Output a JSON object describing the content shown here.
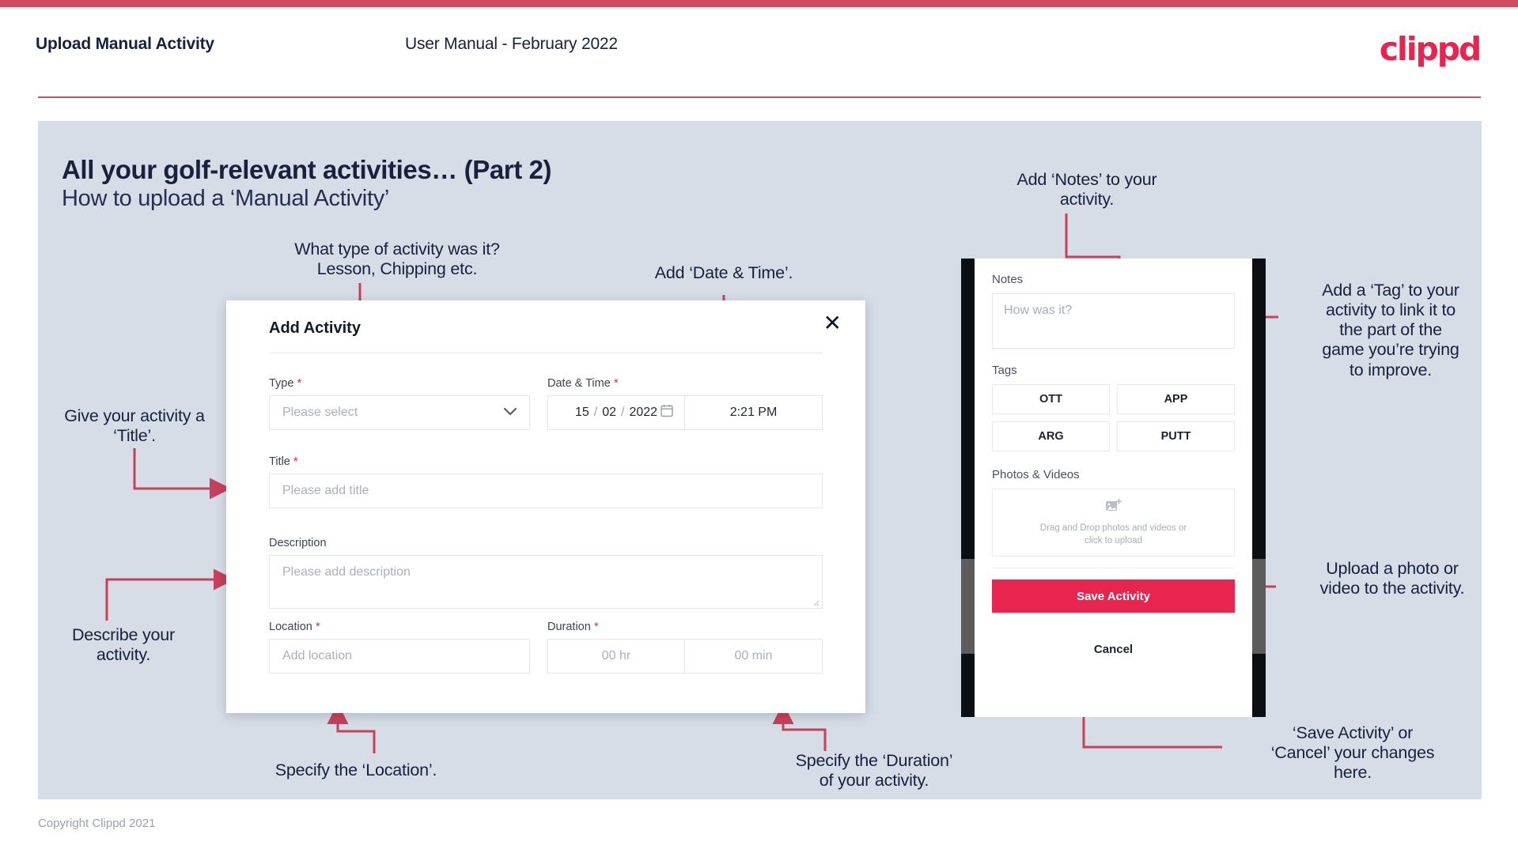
{
  "header": {
    "left_title": "Upload Manual Activity",
    "center_title": "User Manual - February 2022",
    "logo": "clippd"
  },
  "slide": {
    "title": "All your golf-relevant activities… (Part 2)",
    "subtitle": "How to upload a ‘Manual Activity’"
  },
  "annotations": {
    "type": "What type of activity was it?\nLesson, Chipping etc.",
    "datetime": "Add ‘Date & Time’.",
    "notes": "Add ‘Notes’ to your\nactivity.",
    "tag": "Add a ‘Tag’ to your\nactivity to link it to\nthe part of the\ngame you’re trying\nto improve.",
    "title_field": "Give your activity a\n‘Title’.",
    "description": "Describe your\nactivity.",
    "location": "Specify the ‘Location’.",
    "duration": "Specify the ‘Duration’\nof your activity.",
    "upload": "Upload a photo or\nvideo to the activity.",
    "save_cancel": "‘Save Activity’ or\n‘Cancel’ your changes\nhere."
  },
  "modal": {
    "title": "Add Activity",
    "close_icon": "close-icon",
    "fields": {
      "type": {
        "label": "Type",
        "required": "*",
        "placeholder": "Please select",
        "chevron_icon": "chevron-down-icon"
      },
      "datetime": {
        "label": "Date & Time",
        "required": "*",
        "day": "15",
        "month": "02",
        "year": "2022",
        "sep": "/",
        "calendar_icon": "calendar-icon",
        "time": "2:21 PM"
      },
      "title": {
        "label": "Title",
        "required": "*",
        "placeholder": "Please add title"
      },
      "description": {
        "label": "Description",
        "required": "",
        "placeholder": "Please add description"
      },
      "location": {
        "label": "Location",
        "required": "*",
        "placeholder": "Add location"
      },
      "duration": {
        "label": "Duration",
        "required": "*",
        "hours_placeholder": "00 hr",
        "minutes_placeholder": "00 min"
      }
    }
  },
  "phone": {
    "notes": {
      "label": "Notes",
      "placeholder": "How was it?"
    },
    "tags": {
      "label": "Tags",
      "items": [
        "OTT",
        "APP",
        "ARG",
        "PUTT"
      ]
    },
    "photos": {
      "label": "Photos & Videos",
      "icon": "add-image-icon",
      "drop_text": "Drag and Drop photos and videos or\nclick to upload"
    },
    "save_label": "Save Activity",
    "cancel_label": "Cancel"
  },
  "footer": {
    "copyright": "Copyright Clippd 2021"
  },
  "colors": {
    "brand_pink": "#e8254f",
    "bar_red": "#d04a60",
    "slide_bg": "#d7dde6",
    "ink": "#16213f",
    "arrow": "#c8405c"
  }
}
